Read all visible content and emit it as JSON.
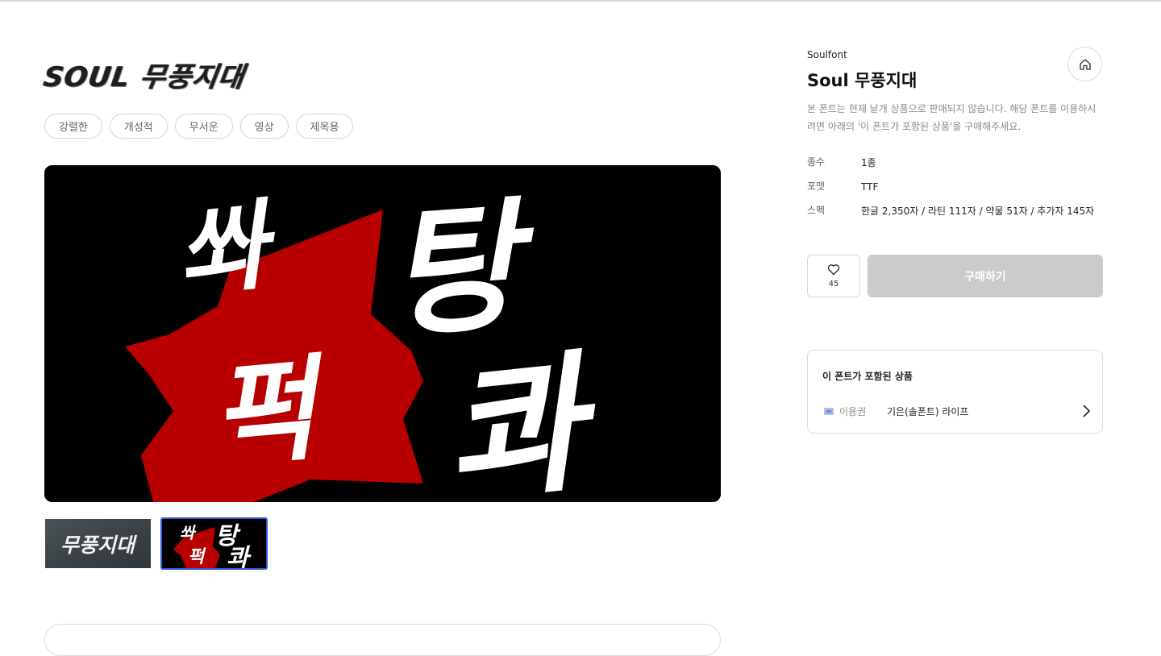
{
  "page": {
    "logo_title": "SOUL 무풍지대",
    "tags": [
      "강렬한",
      "개성적",
      "무서운",
      "영상",
      "제목용"
    ],
    "hero": {
      "words": [
        "쏴",
        "탕",
        "퍽",
        "콰"
      ],
      "colors": {
        "background": "#000000",
        "burst": "#b80000",
        "text": "#ffffff"
      }
    },
    "thumbnails": [
      {
        "text": "무풍지대",
        "active": false
      },
      {
        "words": [
          "쏴",
          "탕",
          "퍽",
          "콰"
        ],
        "active": true
      }
    ]
  },
  "sidebar": {
    "brand": "Soulfont",
    "font_name": "Soul 무풍지대",
    "home_icon": "home-icon",
    "notice": "본 폰트는 현재 낱개 상품으로 판매되지 않습니다. 해당 폰트를 이용하시려면 아래의 '이 폰트가 포함된 상품'을 구매해주세요.",
    "specs": [
      {
        "key": "종수",
        "value": "1종"
      },
      {
        "key": "포맷",
        "value": "TTF"
      },
      {
        "key": "스펙",
        "value": "한글 2,350자 / 라틴 111자 / 약물 51자 / 추가자 145자"
      }
    ],
    "like": {
      "icon": "heart-icon",
      "count": "45"
    },
    "buy_label": "구매하기",
    "included": {
      "title": "이 폰트가 포함된 상품",
      "items": [
        {
          "icon": "ticket-icon",
          "type": "이용권",
          "name": "기은(솔폰트) 라이프",
          "arrow": "chevron-right-icon"
        }
      ]
    }
  },
  "colors": {
    "accent_border": "#2f5bd9",
    "buy_disabled": "#cbcbcb"
  }
}
